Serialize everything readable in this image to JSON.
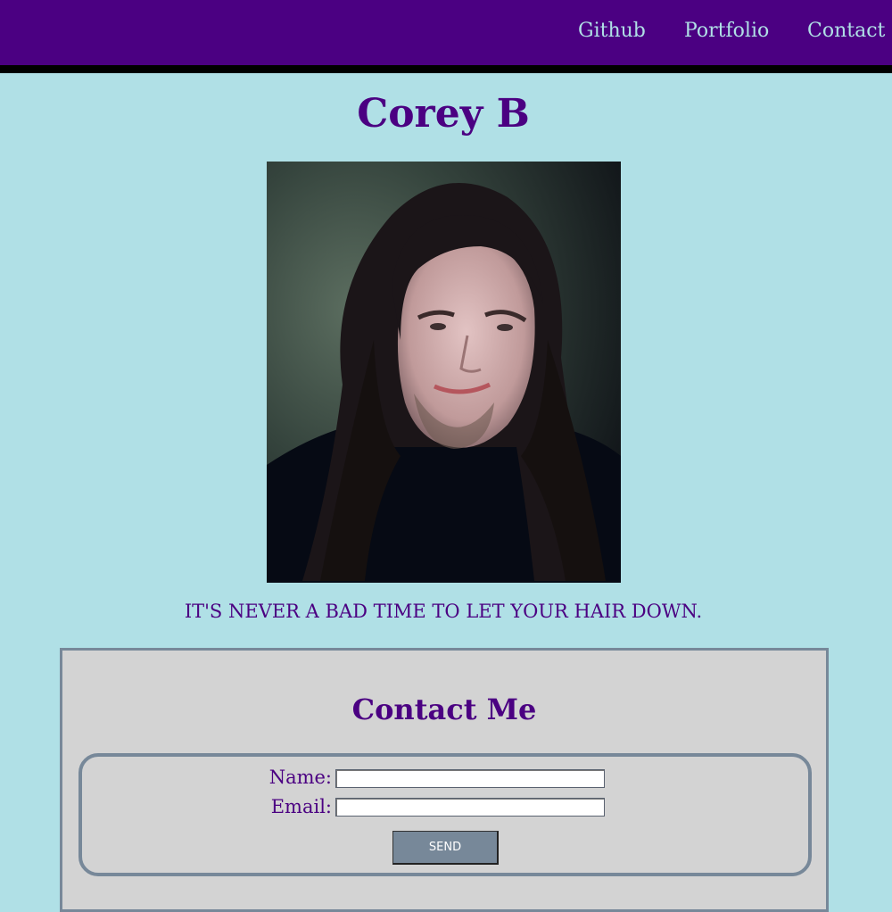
{
  "nav": {
    "links": [
      {
        "label": "Github"
      },
      {
        "label": "Portfolio"
      },
      {
        "label": "Contact"
      }
    ]
  },
  "header": {
    "title": "Corey B"
  },
  "profile": {
    "photo_icon": "portrait-photo-icon",
    "tagline": "IT'S NEVER A BAD TIME TO LET YOUR HAIR DOWN."
  },
  "contact": {
    "title": "Contact Me",
    "name_label": "Name:",
    "name_value": "",
    "email_label": "Email:",
    "email_value": "",
    "send_label": "SEND"
  },
  "colors": {
    "background": "#b0e0e6",
    "navbar": "#4b0082",
    "accent_text": "#4b0082",
    "nav_link_text": "#b0e0e6",
    "card": "#d3d3d3",
    "border": "#778899",
    "button": "#778899"
  }
}
